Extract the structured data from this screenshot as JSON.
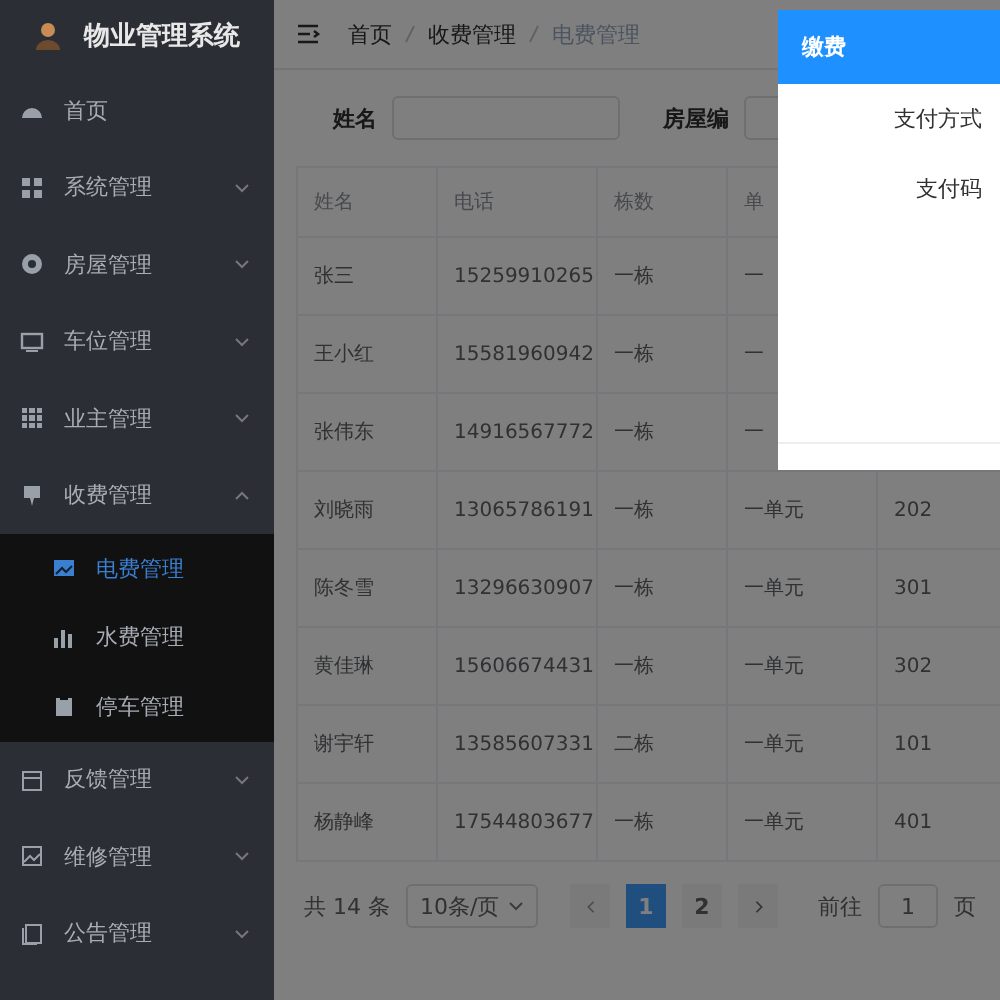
{
  "app": {
    "title": "物业管理系统"
  },
  "sidebar": {
    "items": [
      {
        "label": "首页"
      },
      {
        "label": "系统管理",
        "expanded": false
      },
      {
        "label": "房屋管理",
        "expanded": false
      },
      {
        "label": "车位管理",
        "expanded": false
      },
      {
        "label": "业主管理",
        "expanded": false
      },
      {
        "label": "收费管理",
        "expanded": true,
        "children": [
          {
            "label": "电费管理",
            "selected": true
          },
          {
            "label": "水费管理",
            "selected": false
          },
          {
            "label": "停车管理",
            "selected": false
          }
        ]
      },
      {
        "label": "反馈管理",
        "expanded": false
      },
      {
        "label": "维修管理",
        "expanded": false
      },
      {
        "label": "公告管理",
        "expanded": false
      }
    ]
  },
  "breadcrumb": [
    "首页",
    "收费管理",
    "电费管理"
  ],
  "search": {
    "fields": [
      {
        "label": "姓名"
      },
      {
        "label": "房屋编"
      }
    ]
  },
  "table": {
    "columns": [
      "姓名",
      "电话",
      "栋数",
      "单"
    ],
    "rows": [
      [
        "张三",
        "15259910265",
        "一栋",
        "一"
      ],
      [
        "王小红",
        "15581960942",
        "一栋",
        "一"
      ],
      [
        "张伟东",
        "14916567772",
        "一栋",
        "一"
      ],
      [
        "刘晓雨",
        "13065786191",
        "一栋",
        "一单元",
        "202"
      ],
      [
        "陈冬雪",
        "13296630907",
        "一栋",
        "一单元",
        "301"
      ],
      [
        "黄佳琳",
        "15606674431",
        "一栋",
        "一单元",
        "302"
      ],
      [
        "谢宇轩",
        "13585607331",
        "二栋",
        "一单元",
        "101"
      ],
      [
        "杨静峰",
        "17544803677",
        "一栋",
        "一单元",
        "401"
      ]
    ]
  },
  "pagination": {
    "total": "共 14 条",
    "page_size": "10条/页",
    "pages": [
      {
        "label": "1",
        "selected": true
      },
      {
        "label": "2",
        "selected": false
      }
    ],
    "goto_label": "前往",
    "goto_value": "1",
    "goto_suffix": "页"
  },
  "dialog": {
    "title": "缴费",
    "fields": [
      "支付方式",
      "支付码"
    ]
  }
}
